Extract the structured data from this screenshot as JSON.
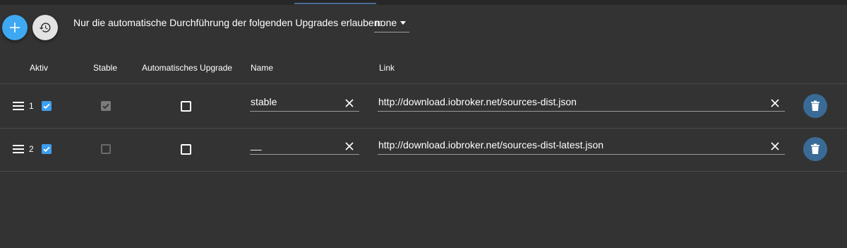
{
  "toolbar": {
    "add_icon": "plus-icon",
    "restore_icon": "restore-icon"
  },
  "upgrade_policy": {
    "label": "Nur die automatische Durchführung der folgenden Upgrades erlauben:",
    "selected": "none"
  },
  "table": {
    "headers": {
      "active": "Aktiv",
      "stable": "Stable",
      "auto_upgrade": "Automatisches Upgrade",
      "name": "Name",
      "link": "Link"
    },
    "rows": [
      {
        "index": "1",
        "active": true,
        "stable": true,
        "auto_upgrade": false,
        "name": "stable",
        "link": "http://download.iobroker.net/sources-dist.json"
      },
      {
        "index": "2",
        "active": true,
        "stable": false,
        "auto_upgrade": false,
        "name": "__",
        "link": "http://download.iobroker.net/sources-dist-latest.json"
      }
    ]
  },
  "colors": {
    "background": "#333333",
    "accent": "#3fa8f2",
    "checkbox": "#3c9ef0",
    "delete_button": "#3a6b96"
  }
}
